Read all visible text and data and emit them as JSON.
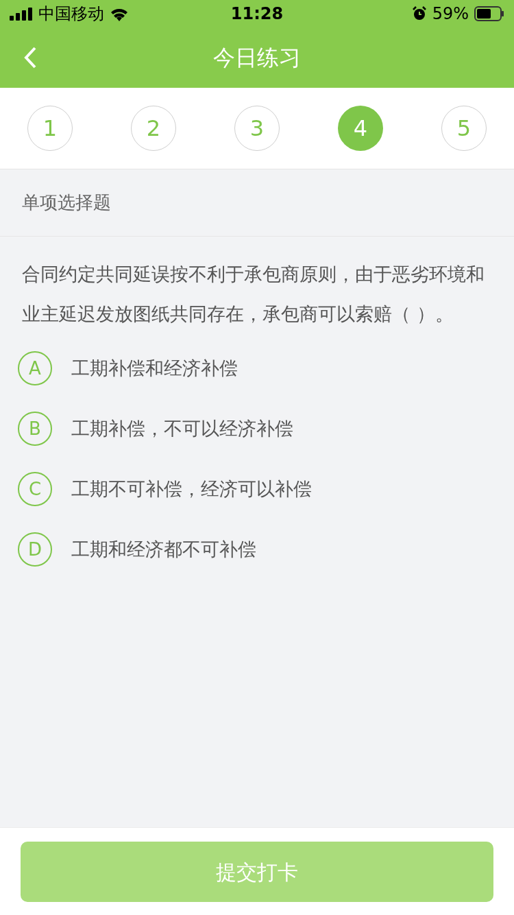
{
  "status_bar": {
    "carrier": "中国移动",
    "time": "11:28",
    "battery": "59%"
  },
  "nav": {
    "title": "今日练习"
  },
  "steps": [
    {
      "label": "1",
      "selected": false
    },
    {
      "label": "2",
      "selected": false
    },
    {
      "label": "3",
      "selected": false
    },
    {
      "label": "4",
      "selected": true
    },
    {
      "label": "5",
      "selected": false
    }
  ],
  "question_type": "单项选择题",
  "question": "合同约定共同延误按不利于承包商原则，由于恶劣环境和业主延迟发放图纸共同存在，承包商可以索赔（ ）。",
  "options": [
    {
      "letter": "A",
      "text": "工期补偿和经济补偿",
      "selected": false
    },
    {
      "letter": "B",
      "text": "工期补偿，不可以经济补偿",
      "selected": false
    },
    {
      "letter": "C",
      "text": "工期不可补偿，经济可以补偿",
      "selected": false
    },
    {
      "letter": "D",
      "text": "工期和经济都不可补偿",
      "selected": false
    }
  ],
  "submit": {
    "label": "提交打卡",
    "disabled": true
  }
}
